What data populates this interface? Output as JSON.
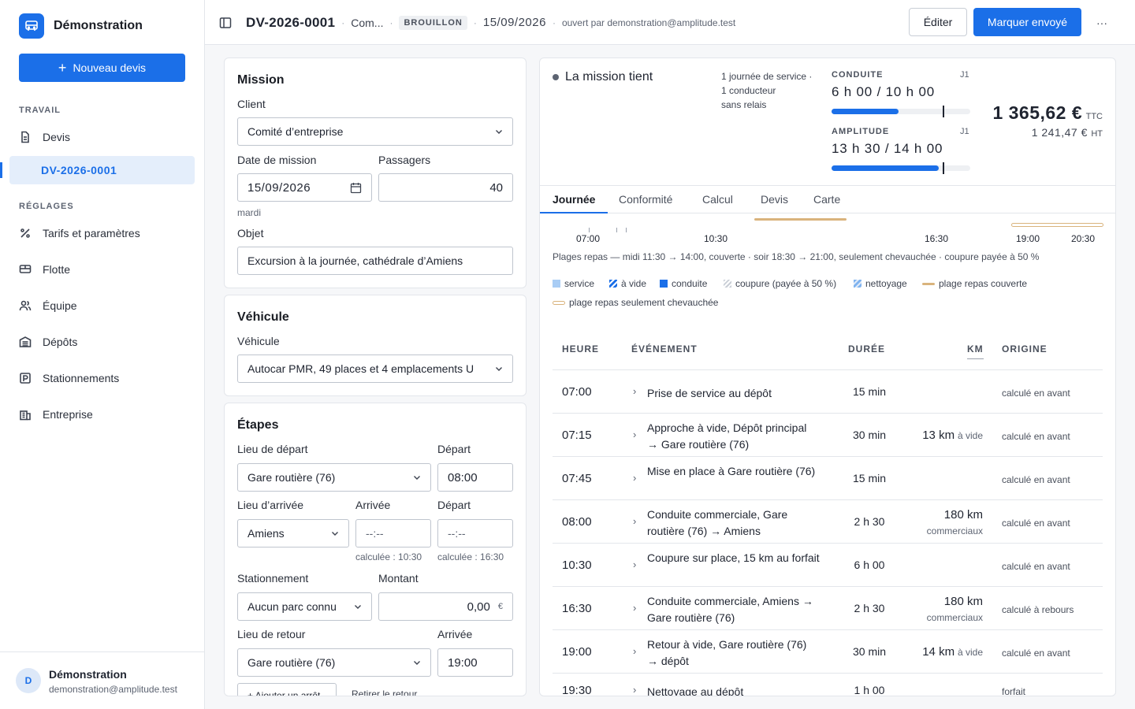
{
  "app": {
    "name": "Démonstration",
    "new_quote": "Nouveau devis"
  },
  "sidebar": {
    "section_work": "TRAVAIL",
    "devis": "Devis",
    "active_quote": "DV-2026-0001",
    "section_settings": "RÉGLAGES",
    "items": [
      "Tarifs et paramètres",
      "Flotte",
      "Équipe",
      "Dépôts",
      "Stationnements",
      "Entreprise"
    ]
  },
  "user": {
    "initial": "D",
    "name": "Démonstration",
    "email": "demonstration@amplitude.test"
  },
  "header": {
    "quote_id": "DV-2026-0001",
    "client_short": "Com...",
    "status": "BROUILLON",
    "date": "15/09/2026",
    "opened_by": "ouvert par demonstration@amplitude.test",
    "edit": "Éditer",
    "mark_sent": "Marquer envoyé",
    "more": "···"
  },
  "mission": {
    "title": "Mission",
    "client_label": "Client",
    "client_value": "Comité d’entreprise",
    "date_label": "Date de mission",
    "date_value": "15/09/2026",
    "weekday": "mardi",
    "passengers_label": "Passagers",
    "passengers_value": "40",
    "object_label": "Objet",
    "object_value": "Excursion à la journée, cathédrale d’Amiens"
  },
  "vehicle": {
    "title": "Véhicule",
    "label": "Véhicule",
    "value": "Autocar PMR, 49 places et 4 emplacements U"
  },
  "stages": {
    "title": "Étapes",
    "departure_place_label": "Lieu de départ",
    "departure_place": "Gare routière (76)",
    "departure_label": "Départ",
    "departure_time": "08:00",
    "arrival_place_label": "Lieu d’arrivée",
    "arrival_place": "Amiens",
    "arrival_label": "Arrivée",
    "arrival_time": "--:--",
    "departure2_label": "Départ",
    "departure2_time": "--:--",
    "computed_arrival": "calculée : 10:30",
    "computed_departure": "calculée : 16:30",
    "parking_label": "Stationnement",
    "parking_value": "Aucun parc connu",
    "amount_label": "Montant",
    "amount_value": "0,00",
    "currency": "€",
    "return_place_label": "Lieu de retour",
    "return_place": "Gare routière (76)",
    "return_arrival_label": "Arrivée",
    "return_arrival": "19:00",
    "add_stop": "+ Ajouter un arrêt",
    "remove_return": "Retirer le retour"
  },
  "summary": {
    "status": "La mission tient",
    "info_line1": "1 journée de service ·",
    "info_line2": "1 conducteur",
    "info_line3": "sans relais",
    "driving_label": "CONDUITE",
    "driving_day": "J1",
    "driving_value": "6 h 00 / 10 h 00",
    "driving_ratio": 0.6,
    "amplitude_label": "AMPLITUDE",
    "amplitude_day": "J1",
    "amplitude_value": "13 h 30 / 14 h 00",
    "amplitude_ratio": 0.964,
    "price_ttc": "1 365,62 €",
    "ttc": "TTC",
    "price_ht": "1 241,47 €",
    "ht": "HT"
  },
  "tabs": [
    "Journée",
    "Conformité",
    "Calcul",
    "Devis",
    "Carte"
  ],
  "timeline": {
    "ticks": [
      "07:00",
      "10:30",
      "16:30",
      "19:00",
      "20:30"
    ],
    "meal_note": "Plages repas — midi 11:30 → 14:00, couverte · soir 18:30 → 21:00, seulement chevauchée · coupure payée à 50 %"
  },
  "legend": [
    "service",
    "à vide",
    "conduite",
    "coupure (payée à 50 %)",
    "nettoyage",
    "plage repas couverte",
    "plage repas seulement chevauchée"
  ],
  "colors": {
    "accent": "#1b6fe8",
    "service": "#a9cdf5",
    "meal_covered": "#d9b37c",
    "success_dot": "#5d6472"
  },
  "table": {
    "headers": [
      "HEURE",
      "ÉVÉNEMENT",
      "DURÉE",
      "KM",
      "ORIGINE"
    ],
    "rows": [
      {
        "time": "07:00",
        "event": "Prise de service au dépôt",
        "duration": "15 min",
        "km": "",
        "km_note": "",
        "origin": "calculé en avant"
      },
      {
        "time": "07:15",
        "event": "Approche à vide, Dépôt principal → Gare routière (76)",
        "duration": "30 min",
        "km": "13 km",
        "km_note": "à vide",
        "origin": "calculé en avant"
      },
      {
        "time": "07:45",
        "event": "Mise en place à Gare routière (76)",
        "duration": "15 min",
        "km": "",
        "km_note": "",
        "origin": "calculé en avant"
      },
      {
        "time": "08:00",
        "event": "Conduite commerciale, Gare routière (76) → Amiens",
        "duration": "2 h 30",
        "km": "180 km",
        "km_note": "commerciaux",
        "origin": "calculé en avant"
      },
      {
        "time": "10:30",
        "event": "Coupure sur place, 15 km au forfait",
        "duration": "6 h 00",
        "km": "",
        "km_note": "",
        "origin": "calculé en avant"
      },
      {
        "time": "16:30",
        "event": "Conduite commerciale, Amiens → Gare routière (76)",
        "duration": "2 h 30",
        "km": "180 km",
        "km_note": "commerciaux",
        "origin": "calculé à rebours"
      },
      {
        "time": "19:00",
        "event": "Retour à vide, Gare routière (76) → dépôt",
        "duration": "30 min",
        "km": "14 km",
        "km_note": "à vide",
        "origin": "calculé en avant"
      },
      {
        "time": "19:30",
        "event": "Nettoyage au dépôt",
        "duration": "1 h 00",
        "km": "",
        "km_note": "",
        "origin": "forfait"
      }
    ]
  }
}
